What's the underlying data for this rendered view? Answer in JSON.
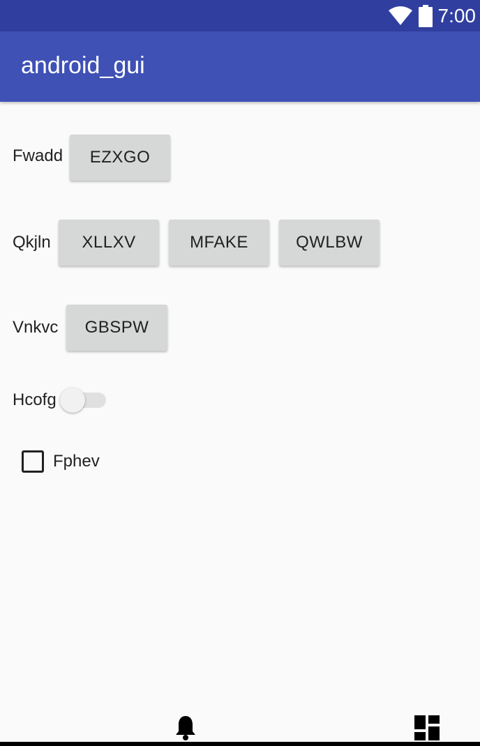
{
  "status_bar": {
    "time": "7:00",
    "icons": [
      "wifi-icon",
      "battery-icon"
    ]
  },
  "app_bar": {
    "title": "android_gui"
  },
  "rows": [
    {
      "label": "Fwadd",
      "buttons": [
        "EZXGO"
      ]
    },
    {
      "label": "Qkjln",
      "buttons": [
        "XLLXV",
        "MFAKE",
        "QWLBW"
      ]
    },
    {
      "label": "Vnkvc",
      "buttons": [
        "GBSPW"
      ]
    }
  ],
  "switch": {
    "label": "Hcofg",
    "checked": false
  },
  "checkbox": {
    "label": "Fphev",
    "checked": false
  },
  "bottom_icons": [
    "bell-icon",
    "dashboard-icon"
  ],
  "colors": {
    "status_bar": "#303f9f",
    "app_bar": "#3f51b5",
    "button": "#d6d7d7",
    "background": "#fafafa"
  }
}
